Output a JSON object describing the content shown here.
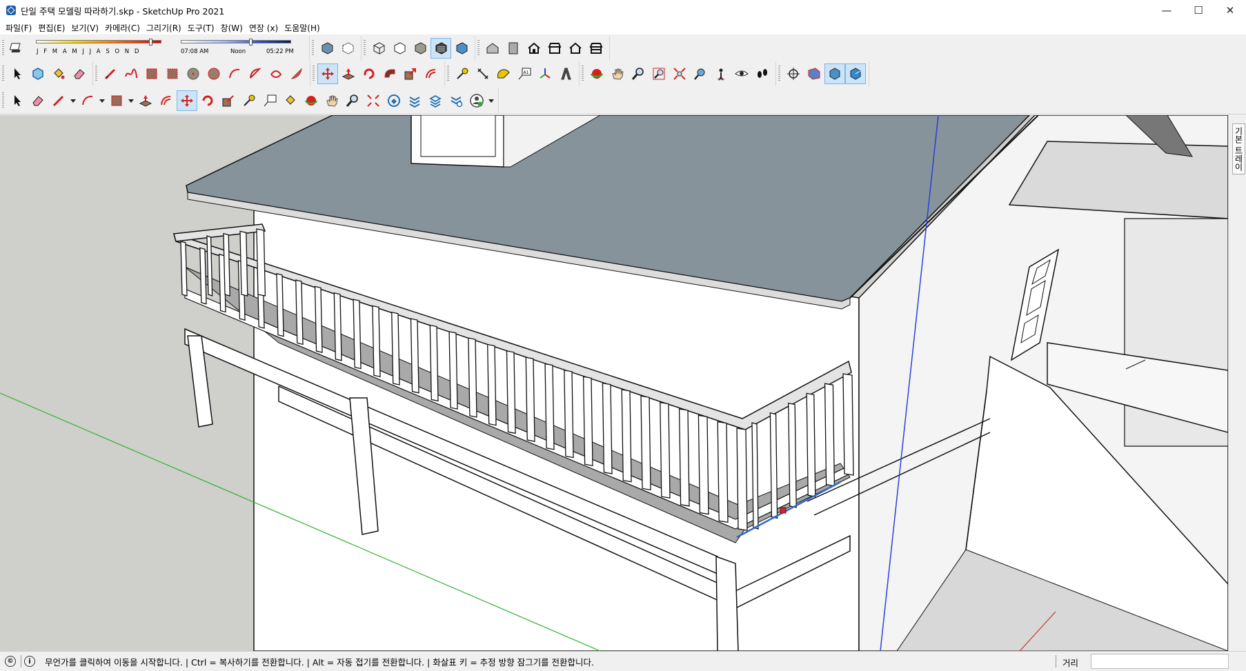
{
  "window": {
    "title": "단일 주택 모델링 따라하기.skp - SketchUp Pro 2021",
    "minimize": "—",
    "maximize": "☐",
    "close": "✕"
  },
  "menu": [
    "파일(F)",
    "편집(E)",
    "보기(V)",
    "카메라(C)",
    "그리기(R)",
    "도구(T)",
    "창(W)",
    "연장 (x)",
    "도움말(H)"
  ],
  "shadow": {
    "months": "J F M A M J J A S O N D",
    "time_start": "07:08 AM",
    "time_mid": "Noon",
    "time_end": "05:22 PM",
    "date_fraction": 0.9,
    "time_fraction": 0.62
  },
  "tray": {
    "label": "기본 트레이"
  },
  "status": {
    "message": "무언가를 클릭하여 이동을 시작합니다. | Ctrl = 복사하기를 전환합니다. | Alt = 자동 접기를 전환합니다. | 화살표 키 = 추정 방향 잠그기를 전환합니다.",
    "measurements_label": "거리",
    "measurements_value": ""
  },
  "colors": {
    "roof": "#86939b",
    "wall": "#ffffff",
    "ground": "#cfcfcb",
    "deck_shadow": "#a9a9a9",
    "accent": "#2f66c6",
    "green_axis": "#2bb32b",
    "blue_axis": "#2b3fd6",
    "red_axis": "#d13030"
  }
}
